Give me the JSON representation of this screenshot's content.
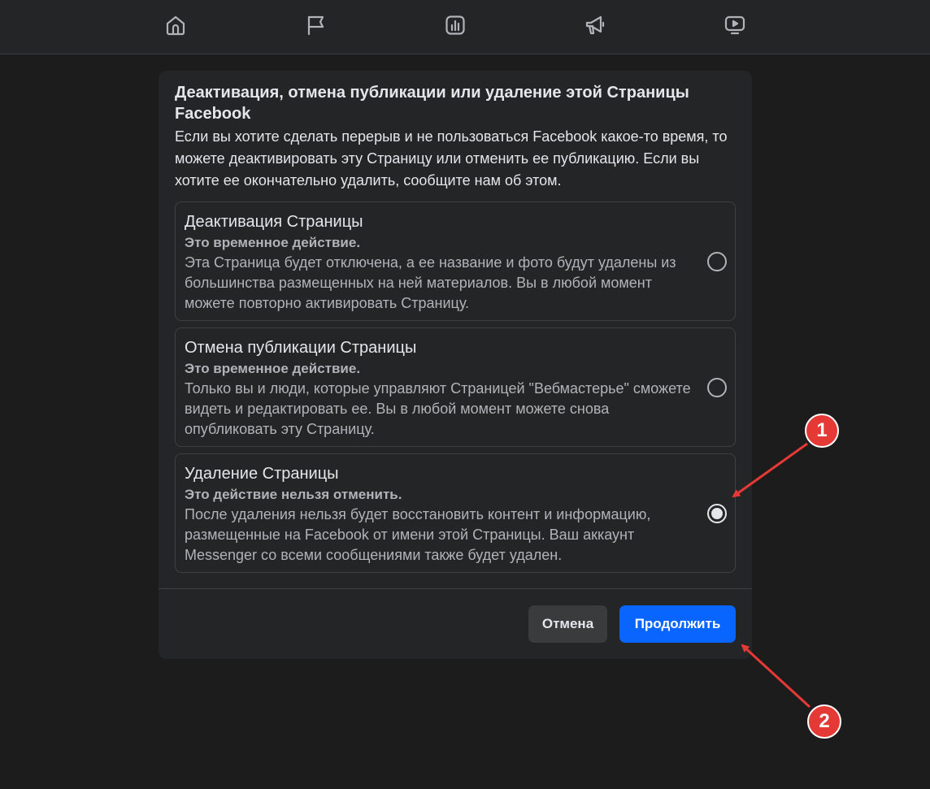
{
  "nav": {
    "icons": [
      "home-icon",
      "flag-icon",
      "insights-icon",
      "megaphone-icon",
      "video-icon"
    ]
  },
  "dialog": {
    "title": "Деактивация, отмена публикации или удаление этой Страницы Facebook",
    "description": "Если вы хотите сделать перерыв и не пользоваться Facebook какое-то время, то можете деактивировать эту Страницу или отменить ее публикацию. Если вы хотите ее окончательно удалить, сообщите нам об этом.",
    "options": [
      {
        "title": "Деактивация Страницы",
        "subtitle": "Это временное действие.",
        "text": "Эта Страница будет отключена, а ее название и фото будут удалены из большинства размещенных на ней материалов. Вы в любой момент можете повторно активировать Страницу.",
        "selected": false
      },
      {
        "title": "Отмена публикации Страницы",
        "subtitle": "Это временное действие.",
        "text": "Только вы и люди, которые управляют Страницей \"Вебмастерье\" сможете видеть и редактировать ее. Вы в любой момент можете снова опубликовать эту Страницу.",
        "selected": false
      },
      {
        "title": "Удаление Страницы",
        "subtitle": "Это действие нельзя отменить.",
        "text": "После удаления нельзя будет восстановить контент и информацию, размещенные на Facebook от имени этой Страницы. Ваш аккаунт Messenger со всеми сообщениями также будет удален.",
        "selected": true
      }
    ],
    "cancel_label": "Отмена",
    "continue_label": "Продолжить"
  },
  "annotations": {
    "badge_1": "1",
    "badge_2": "2",
    "color": "#e53935"
  },
  "colors": {
    "background": "#1c1c1d",
    "surface": "#242526",
    "primary_button": "#0866ff",
    "text_primary": "#e4e6eb",
    "text_secondary": "#b0b3b8"
  }
}
